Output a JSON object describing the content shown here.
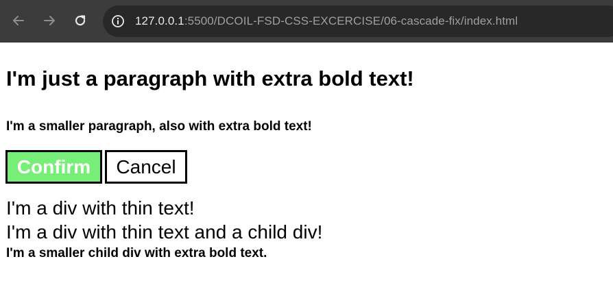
{
  "browser": {
    "back_icon": "arrow-left-icon",
    "forward_icon": "arrow-right-icon",
    "reload_icon": "reload-icon",
    "site_info_icon": "info-circle-icon",
    "url_host": "127.0.0.1",
    "url_rest": ":5500/DCOIL-FSD-CSS-EXCERCISE/06-cascade-fix/index.html"
  },
  "page": {
    "paragraph_large": "I'm just a paragraph with extra bold text!",
    "paragraph_small": "I'm a smaller paragraph, also with extra bold text!",
    "confirm_label": "Confirm",
    "cancel_label": "Cancel",
    "div_thin": "I'm a div with thin text!",
    "div_parent": "I'm a div with thin text and a child div!",
    "div_child": "I'm a smaller child div with extra bold text."
  },
  "colors": {
    "chrome_bg": "#3c3c3c",
    "omnibox_bg": "#282828",
    "confirm_bg": "#77ee77",
    "page_bg": "#ffffff"
  }
}
